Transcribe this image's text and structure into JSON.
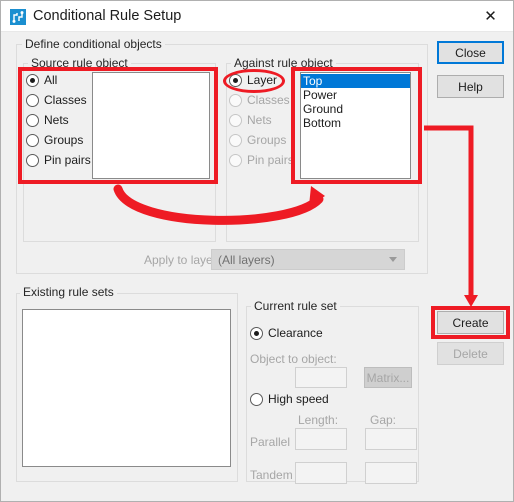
{
  "window": {
    "title": "Conditional Rule Setup",
    "icon": "pcb-trace-icon",
    "close_label": "✕"
  },
  "colors": {
    "accent": "#0078d7",
    "annotation": "#ee1b24",
    "dialog_bg": "#f0f0f0",
    "selection": "#0078d7"
  },
  "define_conditional_objects": {
    "label": "Define conditional objects",
    "source_rule_object": {
      "label": "Source rule object",
      "options": [
        {
          "label": "All",
          "checked": true,
          "enabled": true
        },
        {
          "label": "Classes",
          "checked": false,
          "enabled": true
        },
        {
          "label": "Nets",
          "checked": false,
          "enabled": true
        },
        {
          "label": "Groups",
          "checked": false,
          "enabled": true
        },
        {
          "label": "Pin pairs",
          "checked": false,
          "enabled": true
        }
      ],
      "list_items": []
    },
    "against_rule_object": {
      "label": "Against rule object",
      "options": [
        {
          "label": "Layer",
          "checked": true,
          "enabled": true
        },
        {
          "label": "Classes",
          "checked": false,
          "enabled": false
        },
        {
          "label": "Nets",
          "checked": false,
          "enabled": false
        },
        {
          "label": "Groups",
          "checked": false,
          "enabled": false
        },
        {
          "label": "Pin pairs",
          "checked": false,
          "enabled": false
        }
      ],
      "list_items": [
        {
          "label": "Top",
          "selected": true
        },
        {
          "label": "Power",
          "selected": false
        },
        {
          "label": "Ground",
          "selected": false
        },
        {
          "label": "Bottom",
          "selected": false
        }
      ]
    },
    "apply_to_layer": {
      "label": "Apply to layer:",
      "value": "(All layers)",
      "enabled": false
    }
  },
  "existing_rule_sets": {
    "label": "Existing rule sets",
    "items": []
  },
  "current_rule_set": {
    "label": "Current rule set",
    "clearance": {
      "label": "Clearance",
      "checked": true,
      "object_to_object_label": "Object to object:",
      "object_to_object_value": "",
      "matrix_button": "Matrix..."
    },
    "high_speed": {
      "label": "High speed",
      "checked": false,
      "length_header": "Length:",
      "gap_header": "Gap:",
      "parallel_label": "Parallel",
      "parallel_length": "",
      "parallel_gap": "",
      "tandem_label": "Tandem",
      "tandem_length": "",
      "tandem_gap": ""
    }
  },
  "buttons": {
    "close": "Close",
    "help": "Help",
    "create": "Create",
    "delete": "Delete"
  },
  "annotations": {
    "highlight_source_box": "red-rectangle-source-rule-object",
    "highlight_against_box": "red-rectangle-against-rule-list",
    "highlight_layer_radio": "red-ellipse-layer-radio",
    "highlight_create_button": "red-rectangle-create-button",
    "arrow_source_to_against": "red-curved-arrow",
    "arrow_against_to_create": "red-elbow-arrow"
  }
}
